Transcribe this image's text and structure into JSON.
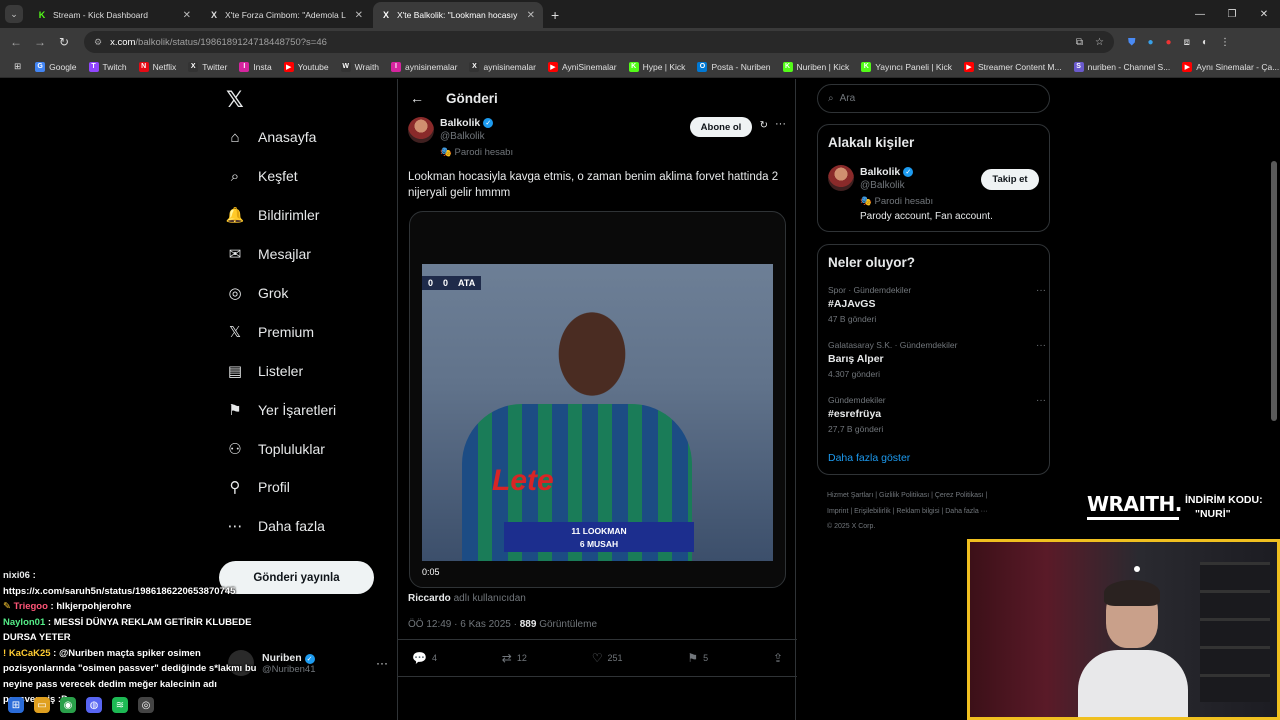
{
  "browser": {
    "tabs": [
      {
        "title": "Stream - Kick Dashboard",
        "icon": "K",
        "active": false
      },
      {
        "title": "X'te Forza Cimbom: \"Ademola L",
        "icon": "X",
        "active": false
      },
      {
        "title": "X'te Balkolik: \"Lookman hocasıy",
        "icon": "X",
        "active": true
      }
    ],
    "new_tab": "+",
    "url_host": "x.com",
    "url_path": "/balkolik/status/1986189124718448750?s=46"
  },
  "bookmarks": [
    {
      "label": "Google",
      "icon": "G",
      "color": "#4285f4"
    },
    {
      "label": "Twitch",
      "icon": "T",
      "color": "#9146ff"
    },
    {
      "label": "Netflix",
      "icon": "N",
      "color": "#e50914"
    },
    {
      "label": "Twitter",
      "icon": "X",
      "color": "#333333"
    },
    {
      "label": "Insta",
      "icon": "I",
      "color": "#d6249f"
    },
    {
      "label": "Youtube",
      "icon": "▶",
      "color": "#ff0000"
    },
    {
      "label": "Wraith",
      "icon": "W",
      "color": "#333333"
    },
    {
      "label": "aynisinemalar",
      "icon": "I",
      "color": "#d6249f"
    },
    {
      "label": "aynisinemalar",
      "icon": "X",
      "color": "#333333"
    },
    {
      "label": "AyniSinemalar",
      "icon": "▶",
      "color": "#ff0000"
    },
    {
      "label": "Hype | Kick",
      "icon": "K",
      "color": "#53fc18"
    },
    {
      "label": "Posta - Nuriben",
      "icon": "O",
      "color": "#0078d4"
    },
    {
      "label": "Nuriben | Kick",
      "icon": "K",
      "color": "#53fc18"
    },
    {
      "label": "Yayıncı Paneli | Kick",
      "icon": "K",
      "color": "#53fc18"
    },
    {
      "label": "Streamer Content M...",
      "icon": "▶",
      "color": "#ff0000"
    },
    {
      "label": "nuriben - Channel S...",
      "icon": "S",
      "color": "#6a5acd"
    },
    {
      "label": "Aynı Sinemalar - Ça...",
      "icon": "▶",
      "color": "#ff0000"
    }
  ],
  "nav": {
    "items": [
      {
        "label": "Anasayfa",
        "icon": "⌂"
      },
      {
        "label": "Keşfet",
        "icon": "⌕"
      },
      {
        "label": "Bildirimler",
        "icon": "🔔"
      },
      {
        "label": "Mesajlar",
        "icon": "✉"
      },
      {
        "label": "Grok",
        "icon": "◎"
      },
      {
        "label": "Premium",
        "icon": "𝕏"
      },
      {
        "label": "Listeler",
        "icon": "▤"
      },
      {
        "label": "Yer İşaretleri",
        "icon": "⚑"
      },
      {
        "label": "Topluluklar",
        "icon": "⚇"
      },
      {
        "label": "Profil",
        "icon": "⚲"
      },
      {
        "label": "Daha fazla",
        "icon": "⋯"
      }
    ],
    "post_button": "Gönderi yayınla",
    "account": {
      "name": "Nuriben",
      "handle": "@Nuriben41"
    }
  },
  "main": {
    "title": "Gönderi",
    "tweet": {
      "name": "Balkolik",
      "handle": "@Balkolik",
      "parody": "Parodi hesabı",
      "follow": "Abone ol",
      "text": "Lookman hocasiyla kavga etmis, o zaman benim aklima forvet hattinda 2 nijeryali gelir hmmm",
      "video": {
        "score_home": "0",
        "score_away": "0",
        "team": "ATA",
        "sponsor": "Lete",
        "caption_line1": "11 LOOKMAN",
        "caption_line2": "6 MUSAH",
        "time": "0:05"
      },
      "from_user": "Riccardo",
      "from_suffix": "adlı kullanıcıdan",
      "date": "ÖÖ 12:49 · 6 Kas 2025 ·",
      "views": "889",
      "views_label": "Görüntüleme",
      "replies": "4",
      "reposts": "12",
      "likes": "251",
      "bookmarks": "5"
    }
  },
  "right": {
    "search_placeholder": "Ara",
    "related_title": "Alakalı kişiler",
    "related": {
      "name": "Balkolik",
      "handle": "@Balkolik",
      "parody": "Parodi hesabı",
      "bio": "Parody account, Fan account.",
      "follow": "Takip et"
    },
    "trends_title": "Neler oluyor?",
    "trends": [
      {
        "category": "Spor · Gündemdekiler",
        "name": "#AJAvGS",
        "posts": "47 B gönderi"
      },
      {
        "category": "Galatasaray S.K. · Gündemdekiler",
        "name": "Barış Alper",
        "posts": "4.307 gönderi"
      },
      {
        "category": "Gündemdekiler",
        "name": "#esrefrüya",
        "posts": "27,7 B gönderi"
      }
    ],
    "show_more": "Daha fazla göster",
    "footer_line1": "Hizmet Şartları   |   Gizlilik Politikası   |   Çerez Politikası   |",
    "footer_line2": "Imprint   |   Erişilebilirlik   |   Reklam bilgisi   |   Daha fazla ···",
    "footer_line3": "© 2025 X Corp."
  },
  "overlay": {
    "wraith_logo": "WRAITH.",
    "code_label": "İNDİRİM KODU:",
    "code_value": "\"NURİ\""
  },
  "chat": [
    {
      "user": "nixi06",
      "message": "https://x.com/saruh5n/status/1986186220653870745",
      "badge": "",
      "cls": "u1"
    },
    {
      "user": "Triegoo",
      "message": "hlkjerpohjerohre",
      "badge": "✎",
      "cls": "u2"
    },
    {
      "user": "Naylon01",
      "message": "MESSİ DÜNYA REKLAM GETİRİR KLUBEDE DURSA YETER",
      "badge": "",
      "cls": "u3"
    },
    {
      "user": "KaCaK25",
      "message": "@Nuriben maçta spiker osimen pozisyonlarında \"osimen passver\" dediğinde s*lakmı bu neyine pass verecek dedim meğer kalecinin adı passvermiş :D",
      "badge": "!",
      "cls": "u4"
    }
  ]
}
